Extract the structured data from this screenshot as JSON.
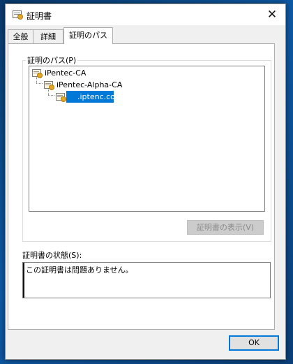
{
  "window": {
    "title": "証明書",
    "close_glyph": "✕"
  },
  "tabs": [
    {
      "label": "全般",
      "active": false
    },
    {
      "label": "詳細",
      "active": false
    },
    {
      "label": "証明のパス",
      "active": true
    }
  ],
  "cert_path": {
    "label": "証明のパス(P)",
    "nodes": [
      {
        "label": "iPentec-CA",
        "level": 0,
        "icon": "certificate-icon"
      },
      {
        "label": "iPentec-Alpha-CA",
        "level": 1,
        "icon": "certificate-icon"
      },
      {
        "label": ".iptenc.com",
        "level": 2,
        "icon": "certificate-icon",
        "selected": true
      }
    ],
    "view_button": "証明書の表示(V)"
  },
  "status": {
    "label": "証明書の状態(S):",
    "text": "この証明書は問題ありません。"
  },
  "ok_button": "OK"
}
